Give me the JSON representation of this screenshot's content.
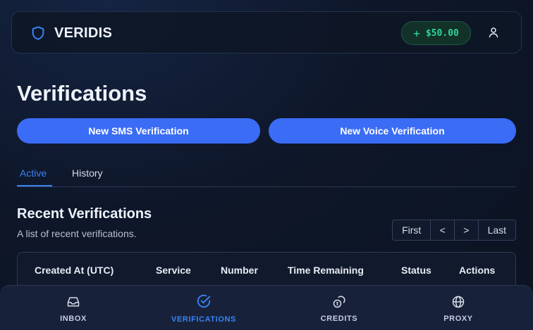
{
  "header": {
    "brand": "VERIDIS",
    "brand_icon": "shield-icon",
    "balance_prefix": "+",
    "balance": "$50.00",
    "user_icon": "user-icon"
  },
  "page": {
    "title": "Verifications",
    "sms_button": "New SMS Verification",
    "voice_button": "New Voice Verification"
  },
  "tabs": [
    {
      "label": "Active",
      "active": true
    },
    {
      "label": "History",
      "active": false
    }
  ],
  "section": {
    "title": "Recent Verifications",
    "subtitle": "A list of recent verifications."
  },
  "pagination": {
    "first": "First",
    "prev": "<",
    "next": ">",
    "last": "Last"
  },
  "table": {
    "columns": [
      "Created At (UTC)",
      "Service",
      "Number",
      "Time Remaining",
      "Status",
      "Actions"
    ]
  },
  "bottom_nav": [
    {
      "label": "INBOX",
      "icon": "inbox-icon",
      "active": false
    },
    {
      "label": "VERIFICATIONS",
      "icon": "check-circle-icon",
      "active": true
    },
    {
      "label": "CREDITS",
      "icon": "coins-icon",
      "active": false
    },
    {
      "label": "PROXY",
      "icon": "globe-icon",
      "active": false
    }
  ],
  "colors": {
    "accent": "#3b6cf6",
    "active_tab": "#3b82f6",
    "balance_green": "#34d399",
    "background": "#0d1526"
  }
}
